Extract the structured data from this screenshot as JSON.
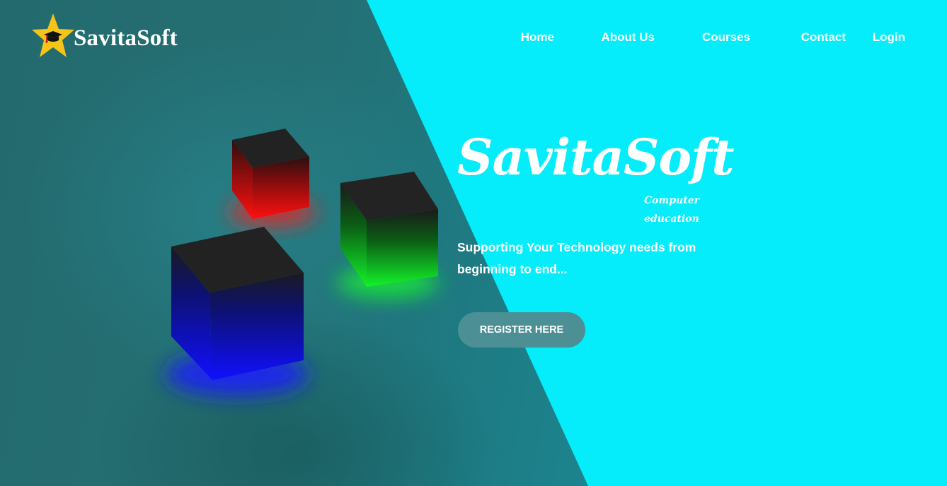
{
  "header": {
    "brand": "SavitaSoft",
    "logo_icon": "star-with-graduation-cap-icon",
    "nav": [
      {
        "label": "Home"
      },
      {
        "label": "About Us"
      },
      {
        "label": "Courses"
      },
      {
        "label": "Contact"
      },
      {
        "label": "Login"
      }
    ]
  },
  "hero": {
    "title": "SavitaSoft",
    "subtitle_line1": "Computer",
    "subtitle_line2": "education",
    "tagline": "Supporting Your Technology needs from beginning to end...",
    "cta_label": "REGISTER HERE"
  },
  "decor": {
    "cubes": [
      {
        "name": "red-cube",
        "glow": "#ff1a1a"
      },
      {
        "name": "green-cube",
        "glow": "#14ff2a"
      },
      {
        "name": "blue-cube",
        "glow": "#1a1aff"
      }
    ]
  },
  "colors": {
    "accent_bg": "#05ecfb",
    "dark_panel": "#236a6e",
    "button_bg": "#4c8f95",
    "logo_star": "#f5c418",
    "text": "#ffffff"
  }
}
